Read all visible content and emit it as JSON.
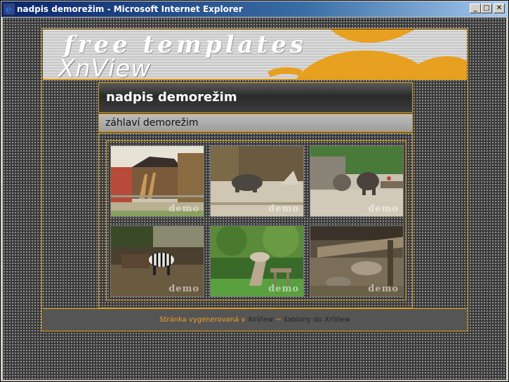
{
  "window": {
    "title": "nadpis demorežim - Microsoft Internet Explorer",
    "buttons": {
      "minimize": "_",
      "maximize": "□",
      "close": "✕"
    }
  },
  "banner": {
    "tagline": "free templates",
    "logo": "XnView"
  },
  "page": {
    "heading": "nadpis demorežim",
    "subheading": "záhlaví demorežim"
  },
  "gallery": {
    "watermark": "demo",
    "thumbnails": [
      {
        "subject": "giraffe"
      },
      {
        "subject": "rhinoceros"
      },
      {
        "subject": "elephants"
      },
      {
        "subject": "zebra"
      },
      {
        "subject": "garden-sculpture"
      },
      {
        "subject": "enclosure"
      }
    ]
  },
  "footer": {
    "prefix": "Stránka vygenerovaná v",
    "link1": "XnView",
    "separator": "~",
    "link2": "šablony do XnView"
  },
  "colors": {
    "accent": "#e0a020",
    "background": "#3a3a3a"
  }
}
